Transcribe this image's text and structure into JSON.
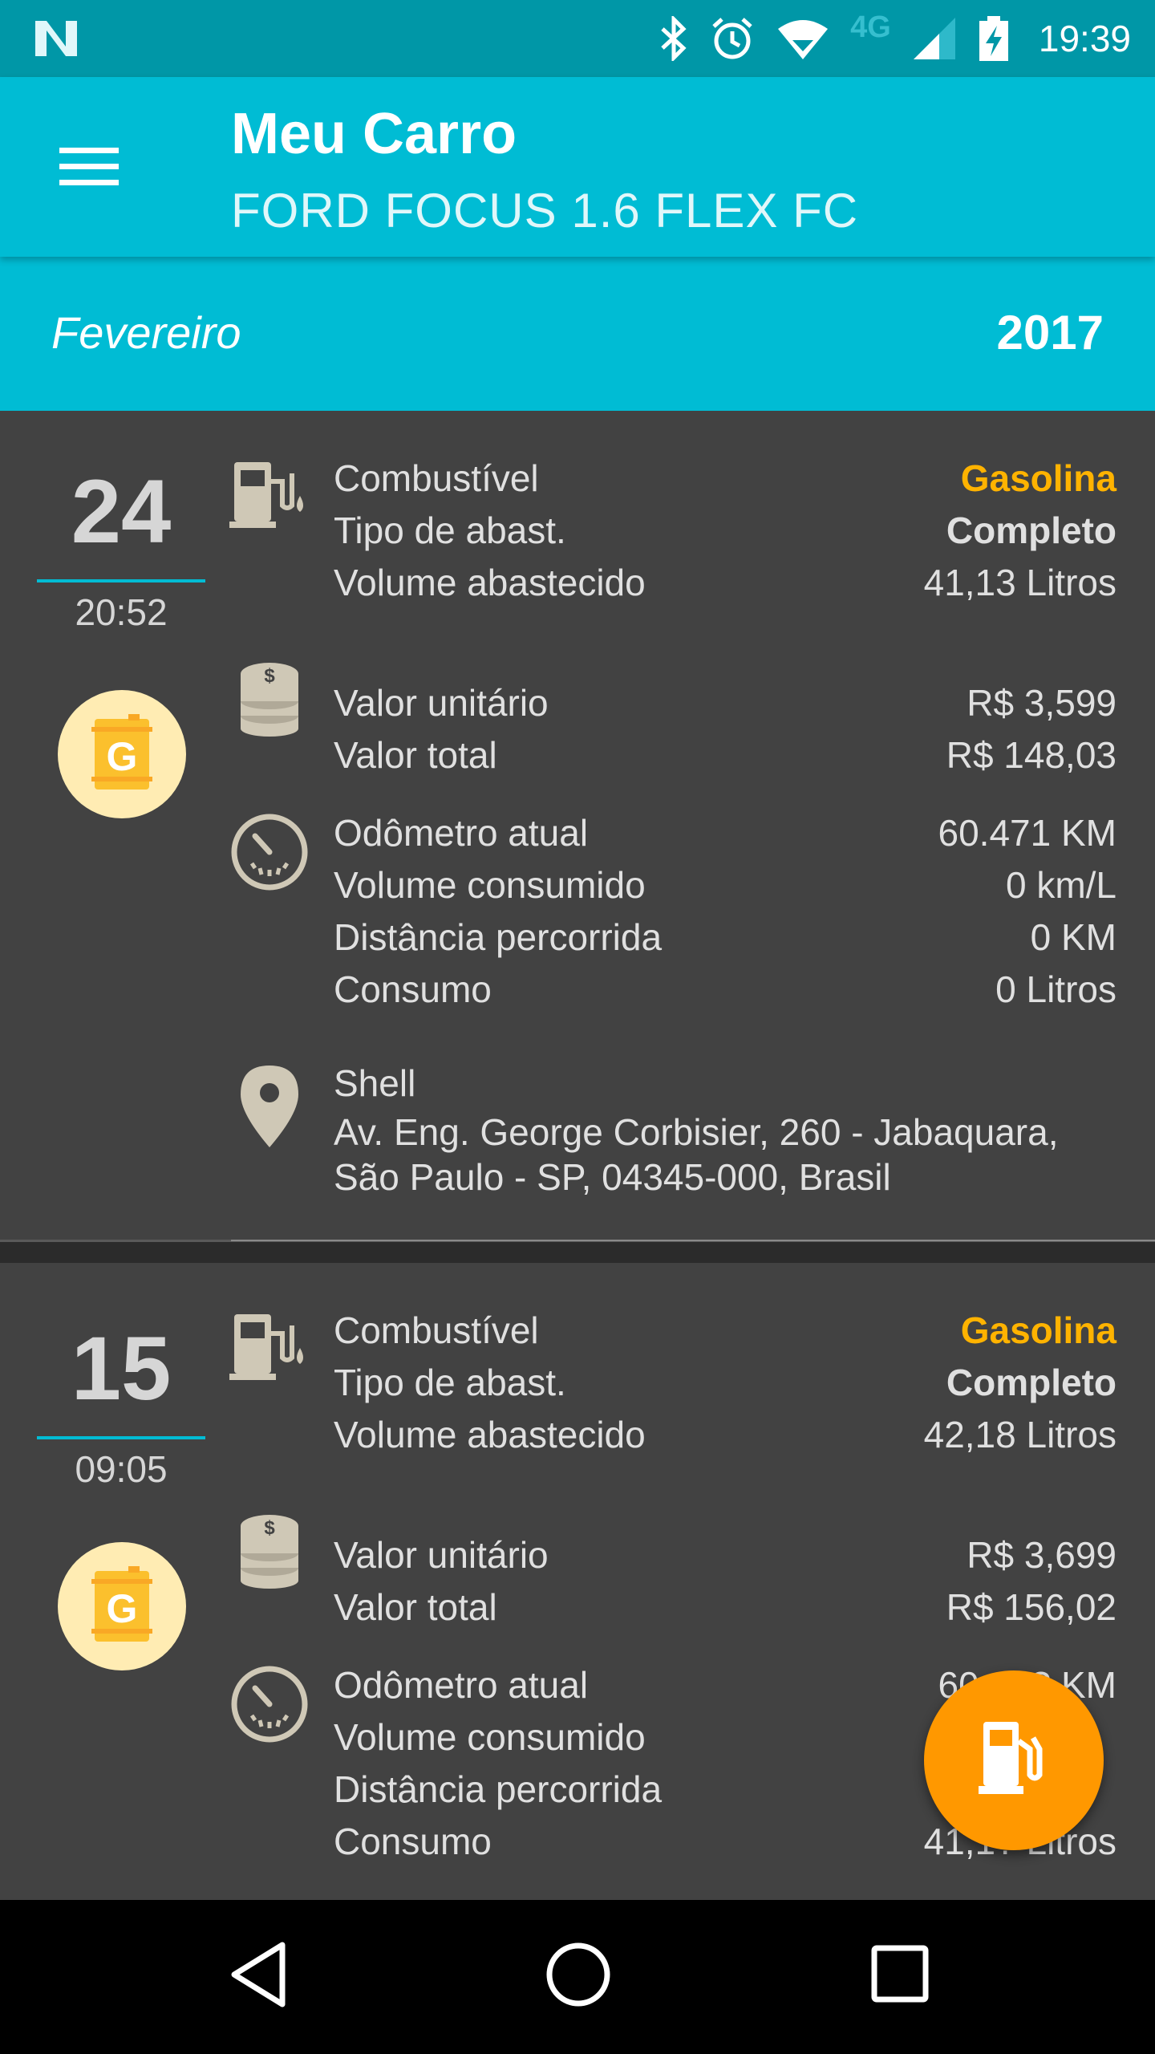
{
  "status_bar": {
    "time": "19:39",
    "network": "4G",
    "icons": [
      "notification-n-icon",
      "bluetooth-icon",
      "alarm-icon",
      "wifi-icon",
      "signal-icon",
      "battery-charging-icon"
    ]
  },
  "app_bar": {
    "title": "Meu Carro",
    "subtitle": "FORD FOCUS 1.6 FLEX FC",
    "menu_icon": "hamburger-menu-icon"
  },
  "period": {
    "month": "Fevereiro",
    "year": "2017"
  },
  "entries": [
    {
      "day": "24",
      "time": "20:52",
      "badge_letter": "G",
      "fuel": [
        {
          "label": "Combustível",
          "value": "Gasolina"
        },
        {
          "label": "Tipo de abast.",
          "value": "Completo"
        },
        {
          "label": "Volume abastecido",
          "value": "41,13 Litros"
        }
      ],
      "cost": [
        {
          "label": "Valor unitário",
          "value": "R$ 3,599"
        },
        {
          "label": "Valor total",
          "value": "R$ 148,03"
        }
      ],
      "odometer": [
        {
          "label": "Odômetro atual",
          "value": "60.471 KM"
        },
        {
          "label": "Volume consumido",
          "value": "0 km/L"
        },
        {
          "label": "Distância percorrida",
          "value": "0 KM"
        },
        {
          "label": "Consumo",
          "value": "0 Litros"
        }
      ],
      "station": {
        "name": "Shell",
        "address_line1": "Av. Eng. George Corbisier, 260 - Jabaquara,",
        "address_line2": "São Paulo - SP, 04345-000, Brasil"
      }
    },
    {
      "day": "15",
      "time": "09:05",
      "badge_letter": "G",
      "fuel": [
        {
          "label": "Combustível",
          "value": "Gasolina"
        },
        {
          "label": "Tipo de abast.",
          "value": "Completo"
        },
        {
          "label": "Volume abastecido",
          "value": "42,18 Litros"
        }
      ],
      "cost": [
        {
          "label": "Valor unitário",
          "value": "R$ 3,699"
        },
        {
          "label": "Valor total",
          "value": "R$ 156,02"
        }
      ],
      "odometer": [
        {
          "label": "Odômetro atual",
          "value": "60.16? KM"
        },
        {
          "label": "Volume consumido",
          "value": ""
        },
        {
          "label": "Distância percorrida",
          "value": ""
        },
        {
          "label": "Consumo",
          "value": "41,1? Litros"
        }
      ]
    }
  ],
  "colors": {
    "status_bar": "#0097a7",
    "app_bar": "#00bcd4",
    "card_bg": "#424242",
    "fuel_accent": "#ffb300",
    "fab": "#ff9800",
    "badge_bg": "#ffecb3"
  },
  "fab": {
    "icon": "gas-pump-icon"
  },
  "nav_bar": {
    "icons": [
      "back-icon",
      "home-icon",
      "recents-icon"
    ]
  }
}
